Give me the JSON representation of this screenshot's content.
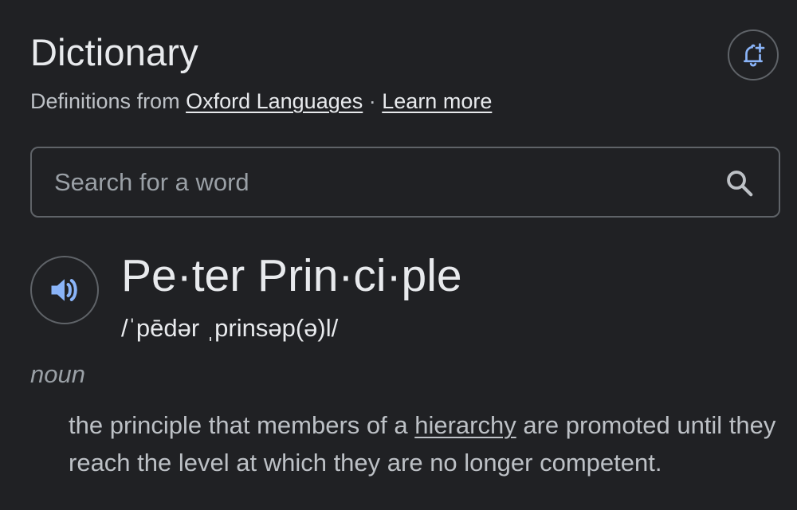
{
  "header": {
    "title": "Dictionary",
    "source_prefix": "Definitions from",
    "source_link": "Oxford Languages",
    "separator": " · ",
    "learn_more": "Learn more"
  },
  "icons": {
    "alert": "add-alert-icon",
    "search": "search-icon",
    "speaker": "speaker-icon"
  },
  "colors": {
    "background": "#202124",
    "accent": "#8ab4f8",
    "text": "#e8eaed",
    "secondary_text": "#bdc1c6",
    "border": "#5f6368"
  },
  "search": {
    "placeholder": "Search for a word"
  },
  "entry": {
    "word": "Pe·ter Prin·ci·ple",
    "pronunciation": "/ˈpēdər ˌprinsəp(ə)l/",
    "part_of_speech": "noun",
    "definition_before": "the principle that members of a ",
    "definition_link": "hierarchy",
    "definition_after": " are promoted until they reach the level at which they are no longer competent."
  }
}
